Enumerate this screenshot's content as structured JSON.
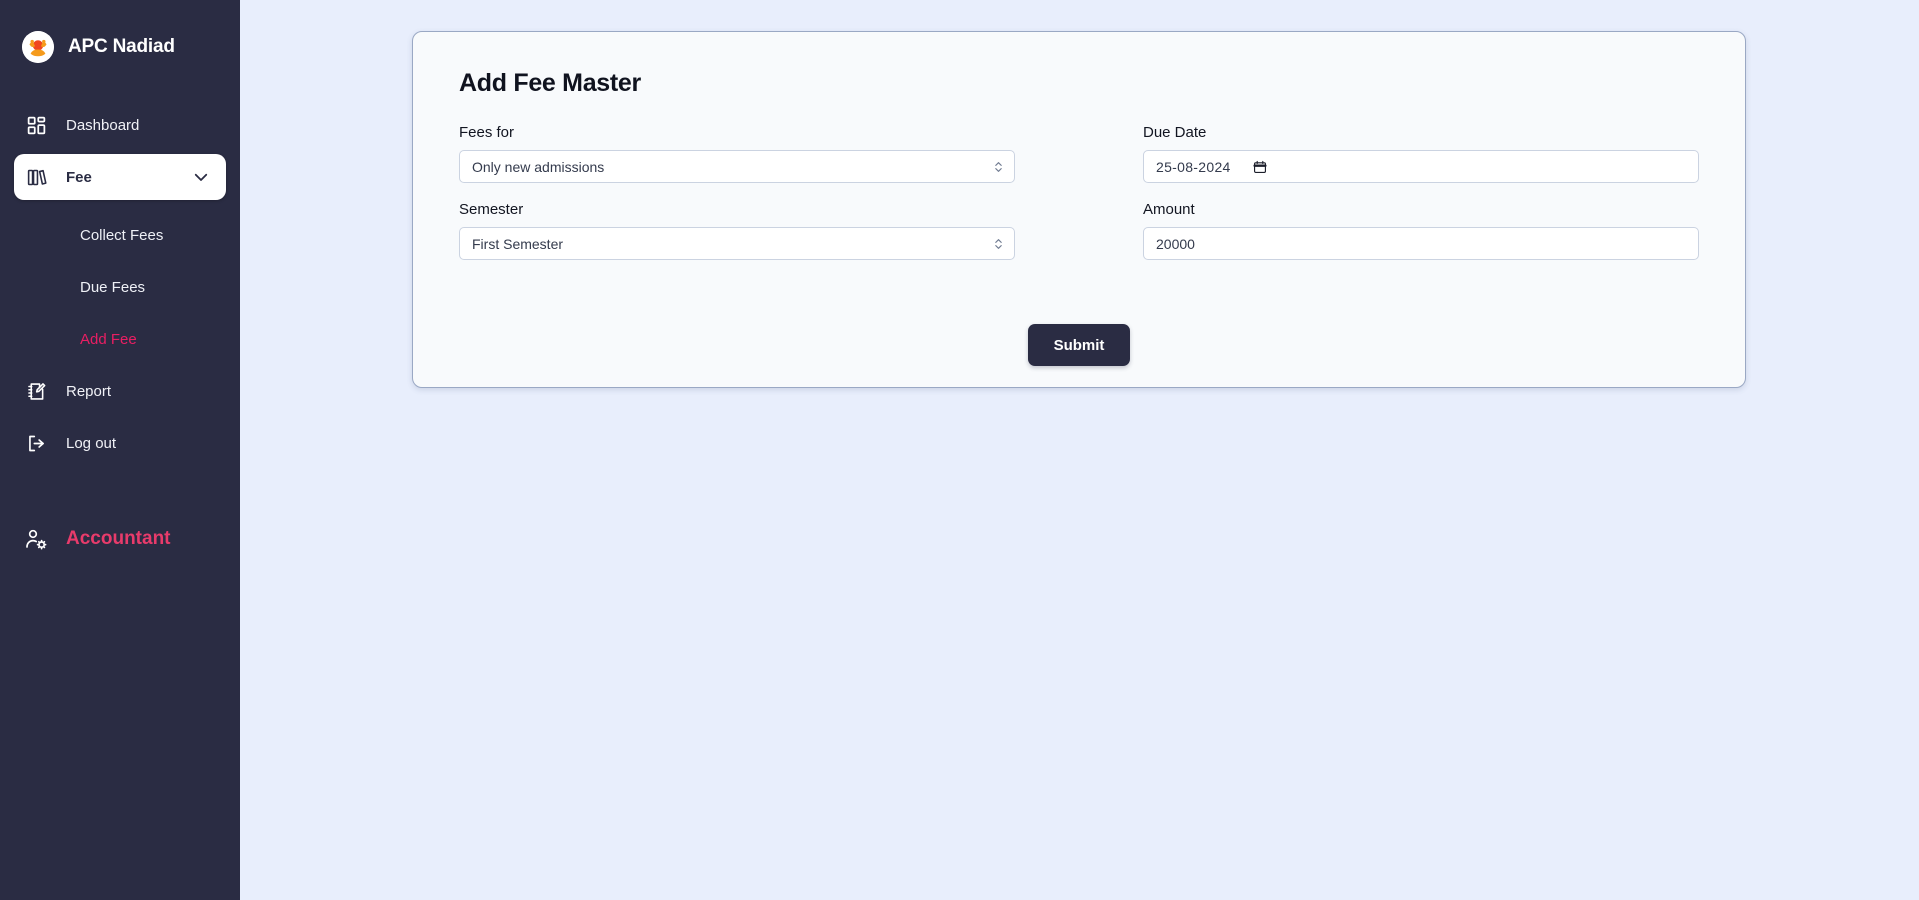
{
  "brand": {
    "title": "APC Nadiad",
    "logo_icon": "sunrise-person-logo-icon"
  },
  "sidebar": {
    "items": [
      {
        "label": "Dashboard",
        "icon": "grid-icon"
      },
      {
        "label": "Fee",
        "icon": "books-icon",
        "expanded": true,
        "chevron": "chevron-down-icon"
      },
      {
        "label": "Report",
        "icon": "notebook-pencil-icon"
      },
      {
        "label": "Log out",
        "icon": "logout-icon"
      }
    ],
    "fee_subitems": [
      {
        "label": "Collect Fees",
        "current": false
      },
      {
        "label": "Due Fees",
        "current": false
      },
      {
        "label": "Add Fee",
        "current": true
      }
    ],
    "role": {
      "label": "Accountant",
      "icon": "user-settings-icon"
    },
    "colors": {
      "background": "#2a2c43",
      "active_pill": "#ffffff",
      "accent_pink": "#e91e63",
      "role_pink": "#e83b6b"
    }
  },
  "page": {
    "background": "#e8eefc"
  },
  "card": {
    "title": "Add Fee Master",
    "background": "#f8fafc",
    "border_color": "#9aa8c4"
  },
  "form": {
    "fees_for": {
      "label": "Fees for",
      "value": "Only new admissions",
      "options": [
        "Only new admissions"
      ],
      "icon": "updown-chevrons-icon"
    },
    "due_date": {
      "label": "Due Date",
      "value": "25-08-2024",
      "input_value": "2024-08-25",
      "icon": "calendar-icon"
    },
    "semester": {
      "label": "Semester",
      "value": "First Semester",
      "options": [
        "First Semester"
      ],
      "icon": "updown-chevrons-icon"
    },
    "amount": {
      "label": "Amount",
      "value": "20000",
      "placeholder": "Amount"
    },
    "submit": {
      "label": "Submit",
      "color": "#2a2c43"
    }
  }
}
